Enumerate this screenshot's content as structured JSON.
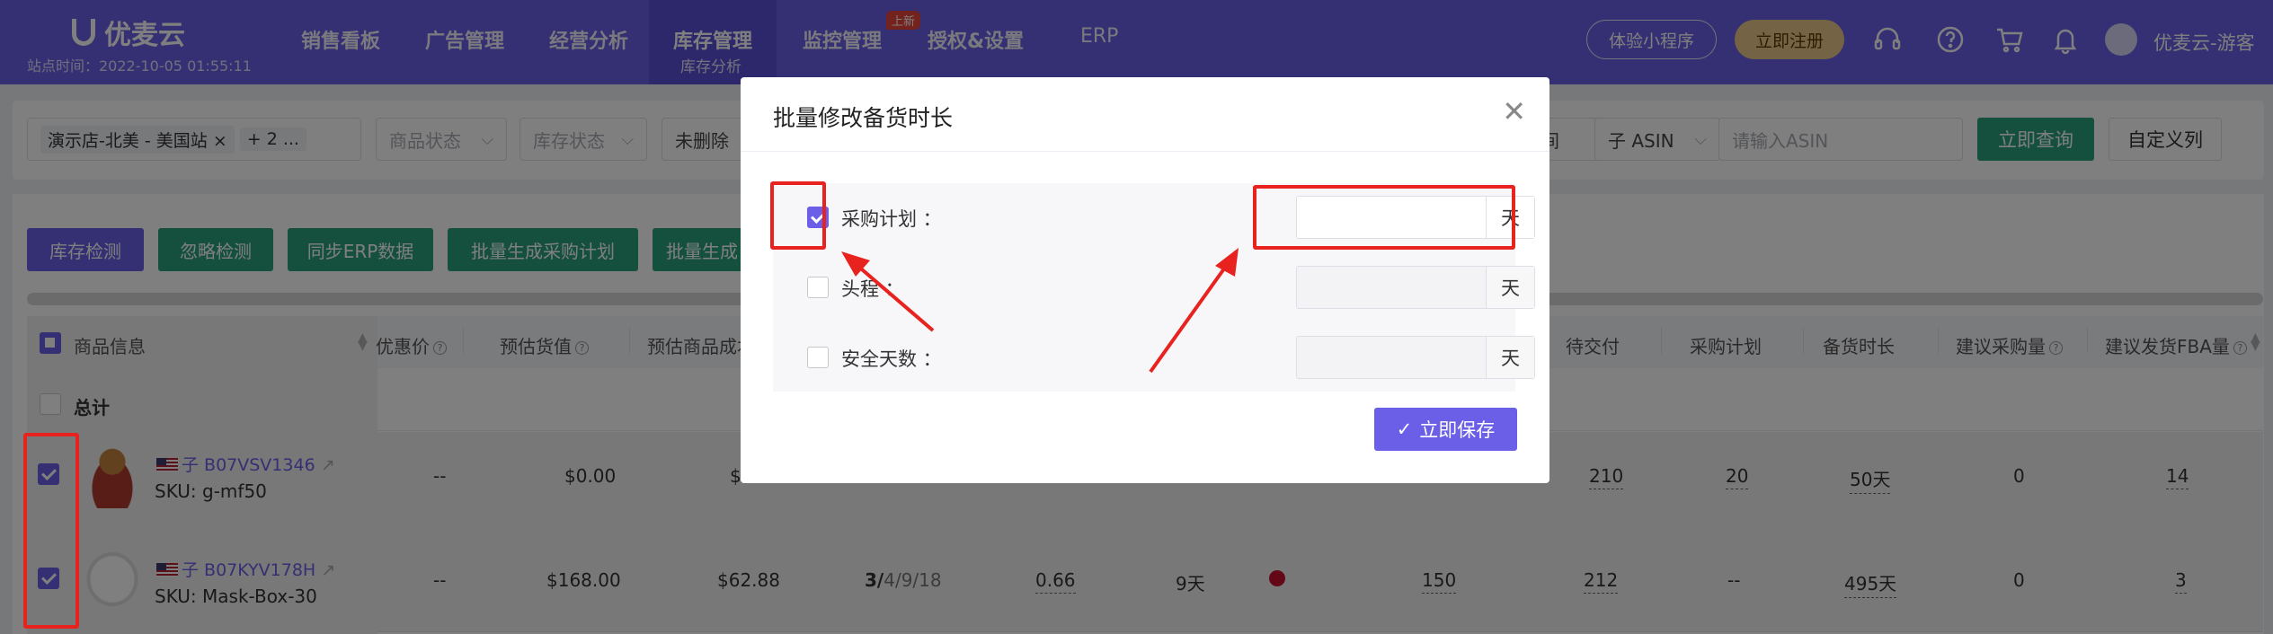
{
  "nav": {
    "brand": "优麦云",
    "site_time": "站点时间：2022-10-05 01:55:11",
    "items": [
      {
        "label": "销售看板"
      },
      {
        "label": "广告管理"
      },
      {
        "label": "经营分析"
      },
      {
        "label": "库存管理",
        "sub": "库存分析",
        "active": true
      },
      {
        "label": "监控管理",
        "badge": "上新"
      },
      {
        "label": "授权&设置"
      },
      {
        "label": "ERP"
      }
    ],
    "trial_button": "体验小程序",
    "register_button": "立即注册",
    "icons": [
      "headset-icon",
      "help-icon",
      "cart-icon",
      "bell-icon"
    ],
    "user": "优麦云-游客"
  },
  "filters": {
    "store": {
      "tag": "演示店-北美 - 美国站",
      "more": "+ 2 ..."
    },
    "product_status": "商品状态",
    "stock_status": "库存状态",
    "deleted": "未删除",
    "suffix_partial": "间",
    "asin_type": "子 ASIN",
    "asin_placeholder": "请输入ASIN",
    "query_button": "立即查询",
    "custom_columns_button": "自定义列"
  },
  "actions": [
    "库存检测",
    "忽略检测",
    "同步ERP数据",
    "批量生成采购计划",
    "批量生成"
  ],
  "table": {
    "headers": {
      "product_info": "商品信息",
      "discount_price": "优惠价",
      "est_value": "预估货值",
      "est_cost": "预估商品成本",
      "pending_delivery": "待交付",
      "purchase_plan": "采购计划",
      "stock_duration": "备货时长",
      "suggest_purchase": "建议采购量",
      "suggest_fba": "建议发货FBA量"
    },
    "total_label": "总计",
    "rows": [
      {
        "asin": "子 B07VSV1346",
        "sku": "SKU: g-mf50",
        "discount": "--",
        "value": "$0.00",
        "cost": "$",
        "pending": "210",
        "plan": "20",
        "duration": "50天",
        "suggest_purchase": "0",
        "suggest_fba": "14"
      },
      {
        "asin": "子 B07KYV178H",
        "sku": "SKU: Mask-Box-30",
        "discount": "--",
        "value": "$168.00",
        "cost": "$62.88",
        "dates_bold": "3/",
        "dates_rest": "4/9/18",
        "ratio": "0.66",
        "days": "9天",
        "inbound": "150",
        "pending": "212",
        "plan": "--",
        "duration": "495天",
        "suggest_purchase": "0",
        "suggest_fba": "3"
      }
    ]
  },
  "modal": {
    "title": "批量修改备货时长",
    "fields": [
      {
        "label": "采购计划 ：",
        "checked": true,
        "value": "",
        "unit": "天"
      },
      {
        "label": "头程 ：",
        "checked": false,
        "value": "",
        "unit": "天"
      },
      {
        "label": "安全天数 ：",
        "checked": false,
        "value": "",
        "unit": "天"
      }
    ],
    "save_button": "立即保存"
  },
  "colors": {
    "brand": "#6a5fe6",
    "green": "#2aa17e",
    "annotation": "#e8231f"
  }
}
